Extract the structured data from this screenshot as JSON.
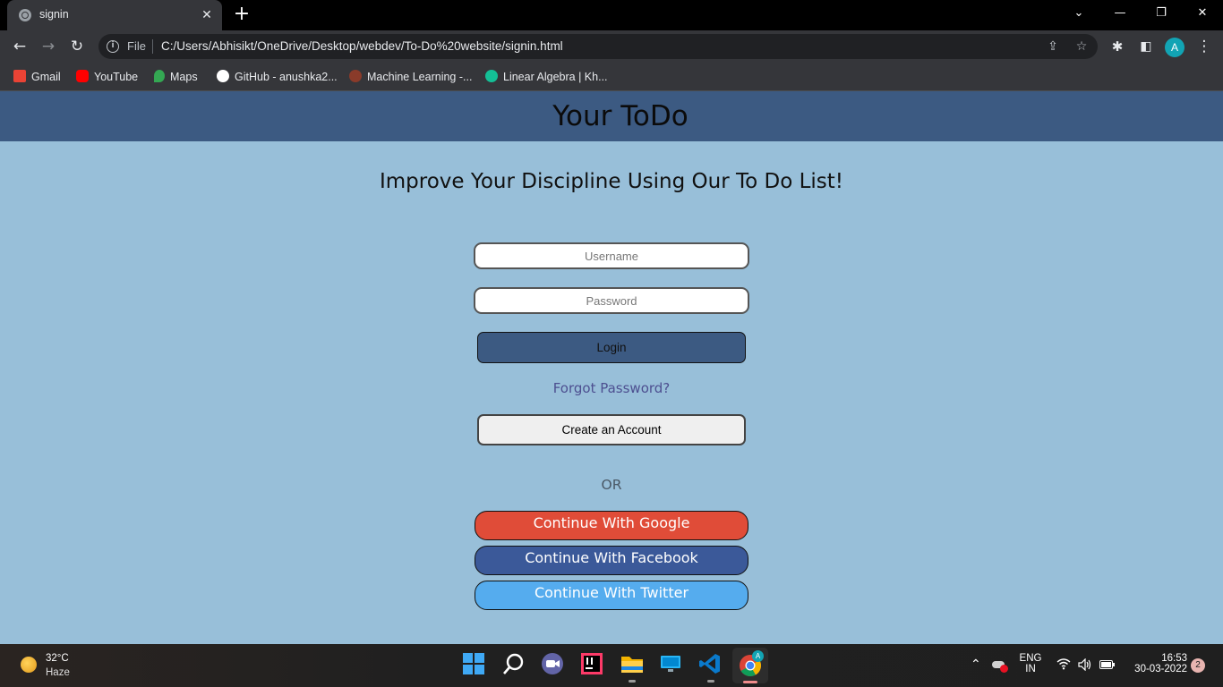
{
  "browser": {
    "tab_title": "signin",
    "new_tab_icon": "+",
    "omnibox": {
      "scheme_label": "File",
      "url": "C:/Users/Abhisikt/OneDrive/Desktop/webdev/To-Do%20website/signin.html"
    },
    "profile_initial": "A",
    "bookmarks": [
      {
        "label": "Gmail",
        "icon": "gmail-icon",
        "color": "#ea4335"
      },
      {
        "label": "YouTube",
        "icon": "youtube-icon",
        "color": "#ff0000"
      },
      {
        "label": "Maps",
        "icon": "maps-icon",
        "color": "#34a853"
      },
      {
        "label": "GitHub - anushka2...",
        "icon": "github-icon",
        "color": "#ffffff"
      },
      {
        "label": "Machine Learning -...",
        "icon": "ml-icon",
        "color": "#8a3b2a"
      },
      {
        "label": "Linear Algebra | Kh...",
        "icon": "khan-academy-icon",
        "color": "#14bf96"
      }
    ]
  },
  "page": {
    "header_title": "Your ToDo",
    "tagline": "Improve Your Discipline Using Our To Do List!",
    "username_placeholder": "Username",
    "password_placeholder": "Password",
    "login_label": "Login",
    "forgot_label": "Forgot Password?",
    "create_label": "Create an Account",
    "or_label": "OR",
    "social": [
      {
        "label": "Continue With Google",
        "color": "#e04c38"
      },
      {
        "label": "Continue With Facebook",
        "color": "#3b5999"
      },
      {
        "label": "Continue With Twitter",
        "color": "#55acee"
      }
    ],
    "colors": {
      "header_bg": "#3c5a82",
      "page_bg": "#98bfd9"
    }
  },
  "taskbar": {
    "weather_temp": "32°C",
    "weather_cond": "Haze",
    "lang": "ENG",
    "region": "IN",
    "time": "16:53",
    "date": "30-03-2022",
    "notifications": "2"
  }
}
